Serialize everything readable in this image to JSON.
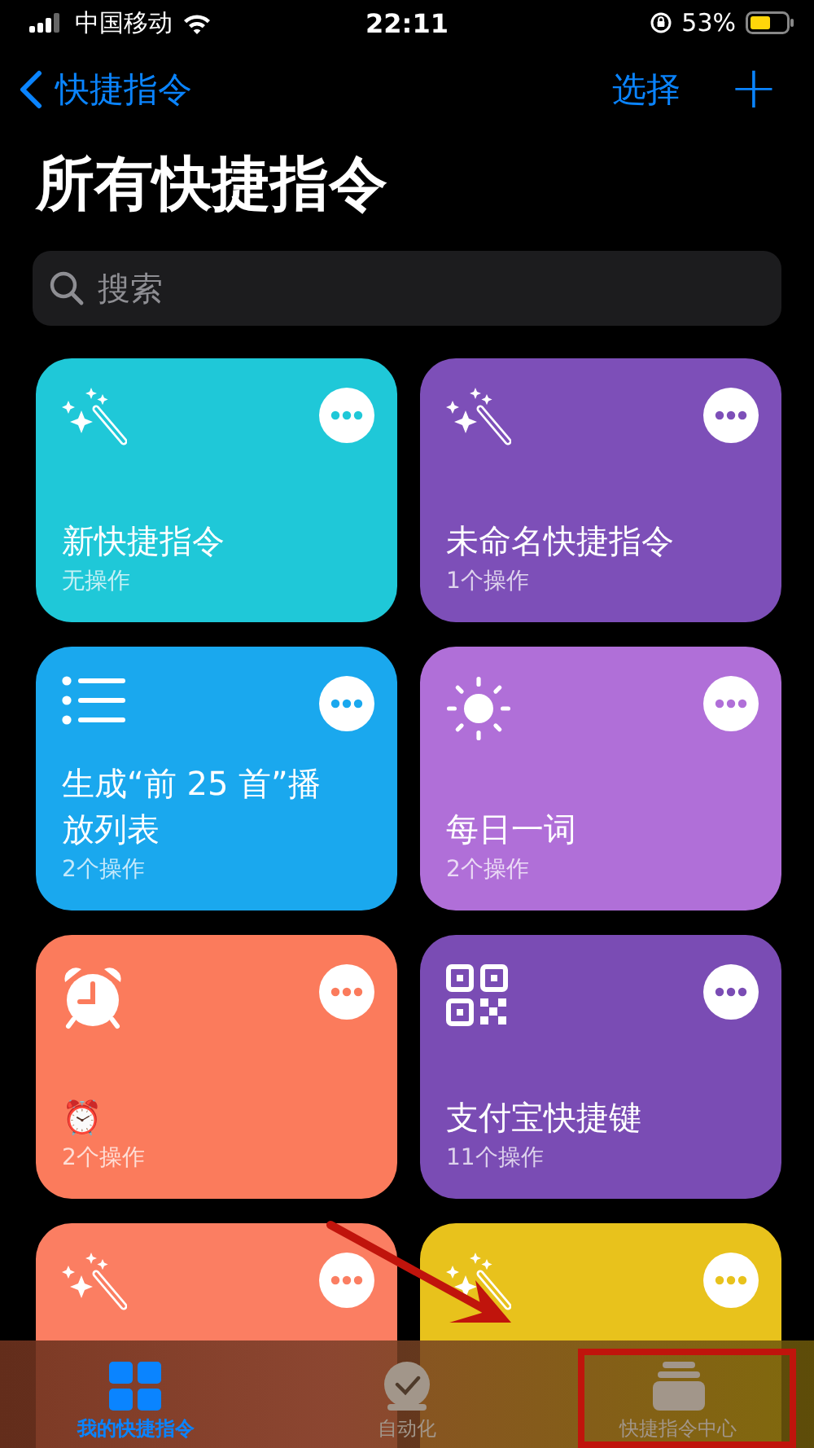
{
  "status_bar": {
    "carrier": "中国移动",
    "time": "22:11",
    "battery": "53%"
  },
  "nav": {
    "back": "快捷指令",
    "select": "选择",
    "add": "+"
  },
  "title": "所有快捷指令",
  "search": {
    "placeholder": "搜索"
  },
  "shortcuts": [
    {
      "kind": "wand",
      "color": "#1fc8d8",
      "title": "新快捷指令",
      "subtitle": "无操作"
    },
    {
      "kind": "wand",
      "color": "#7d4fb8",
      "title": "未命名快捷指令",
      "subtitle": "1个操作"
    },
    {
      "kind": "list",
      "color": "#1aa8ee",
      "title": "生成“前 25 首”播放列表",
      "subtitle": "2个操作"
    },
    {
      "kind": "sun",
      "color": "#b06fd8",
      "title": "每日一词",
      "subtitle": "2个操作"
    },
    {
      "kind": "alarm",
      "color": "#fb7b5c",
      "title": "⏰",
      "subtitle": "2个操作"
    },
    {
      "kind": "qr",
      "color": "#7a4cb4",
      "title": "支付宝快捷键",
      "subtitle": "11个操作"
    },
    {
      "kind": "wand",
      "color": "#fb7e62"
    },
    {
      "kind": "wand",
      "color": "#e8c21c"
    }
  ],
  "tabs": [
    {
      "kind": "grid",
      "label": "我的快捷指令",
      "selected": true
    },
    {
      "kind": "clock",
      "label": "自动化",
      "selected": false
    },
    {
      "kind": "stack",
      "label": "快捷指令中心",
      "selected": false
    }
  ]
}
